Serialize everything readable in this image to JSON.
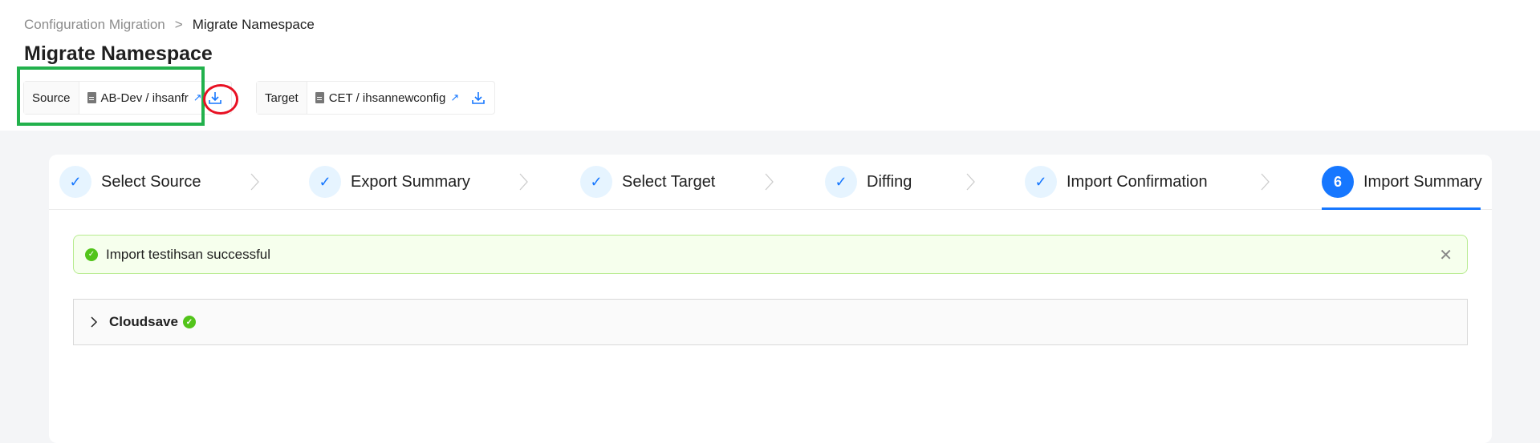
{
  "breadcrumb": {
    "parent": "Configuration Migration",
    "separator": ">",
    "current": "Migrate Namespace"
  },
  "page_title": "Migrate Namespace",
  "source": {
    "label": "Source",
    "value": "AB-Dev / ihsanfr"
  },
  "target": {
    "label": "Target",
    "value": "CET / ihsannewconfig"
  },
  "steps": [
    {
      "label": "Select Source",
      "status": "done"
    },
    {
      "label": "Export Summary",
      "status": "done"
    },
    {
      "label": "Select Target",
      "status": "done"
    },
    {
      "label": "Diffing",
      "status": "done"
    },
    {
      "label": "Import Confirmation",
      "status": "done"
    },
    {
      "label": "Import Summary",
      "status": "active",
      "number": "6"
    }
  ],
  "alert": {
    "message": "Import testihsan successful",
    "type": "success"
  },
  "collapse": {
    "title": "Cloudsave",
    "status": "success"
  },
  "colors": {
    "accent": "#1677ff",
    "success": "#52c41a",
    "annotation_box": "#22b14c",
    "annotation_circle": "#e81123"
  }
}
